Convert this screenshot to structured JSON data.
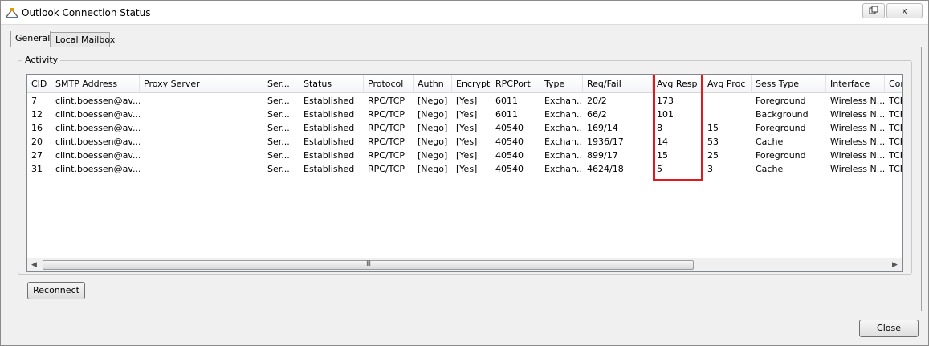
{
  "window": {
    "title": "Outlook Connection Status",
    "restore_icon": "restore-icon",
    "close_glyph": "x"
  },
  "tabs": [
    {
      "label": "General",
      "active": true
    },
    {
      "label": "Local Mailbox",
      "active": false
    }
  ],
  "activity": {
    "group_title": "Activity",
    "columns": [
      "CID",
      "SMTP Address",
      "Proxy Server",
      "Ser...",
      "Status",
      "Protocol",
      "Authn",
      "Encrypt",
      "RPCPort",
      "Type",
      "Req/Fail",
      "Avg Resp",
      "Avg Proc",
      "Sess Type",
      "Interface",
      "Cor"
    ],
    "rows": [
      [
        "7",
        "clint.boessen@av...",
        "",
        "Ser...",
        "Established",
        "RPC/TCP",
        "[Nego]",
        "[Yes]",
        "6011",
        "Exchan...",
        "20/2",
        "173",
        "",
        "Foreground",
        "Wireless N...",
        "TCP"
      ],
      [
        "12",
        "clint.boessen@av...",
        "",
        "Ser...",
        "Established",
        "RPC/TCP",
        "[Nego]",
        "[Yes]",
        "6011",
        "Exchan...",
        "66/2",
        "101",
        "",
        "Background",
        "Wireless N...",
        "TCP"
      ],
      [
        "16",
        "clint.boessen@av...",
        "",
        "Ser...",
        "Established",
        "RPC/TCP",
        "[Nego]",
        "[Yes]",
        "40540",
        "Exchan...",
        "169/14",
        "8",
        "15",
        "Foreground",
        "Wireless N...",
        "TCP"
      ],
      [
        "20",
        "clint.boessen@av...",
        "",
        "Ser...",
        "Established",
        "RPC/TCP",
        "[Nego]",
        "[Yes]",
        "40540",
        "Exchan...",
        "1936/17",
        "14",
        "53",
        "Cache",
        "Wireless N...",
        "TCP"
      ],
      [
        "27",
        "clint.boessen@av...",
        "",
        "Ser...",
        "Established",
        "RPC/TCP",
        "[Nego]",
        "[Yes]",
        "40540",
        "Exchan...",
        "899/17",
        "15",
        "25",
        "Foreground",
        "Wireless N...",
        "TCP"
      ],
      [
        "31",
        "clint.boessen@av...",
        "",
        "Ser...",
        "Established",
        "RPC/TCP",
        "[Nego]",
        "[Yes]",
        "40540",
        "Exchan...",
        "4624/18",
        "5",
        "3",
        "Cache",
        "Wireless N...",
        "TCP"
      ]
    ],
    "highlight_color": "#e2181f",
    "scroll_grip": "III"
  },
  "buttons": {
    "reconnect_label": "Reconnect",
    "close_label": "Close"
  }
}
